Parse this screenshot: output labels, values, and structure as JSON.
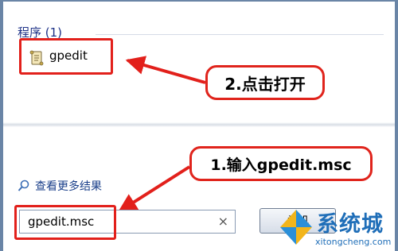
{
  "start_menu": {
    "section_header": "程序 (1)",
    "program_item": {
      "label": "gpedit",
      "icon": "document-scroll-icon"
    },
    "more_results": {
      "label": "查看更多结果",
      "icon": "magnifier-icon"
    },
    "search": {
      "value": "gpedit.msc",
      "clear_icon": "×"
    },
    "shutdown_button": {
      "label": "关机"
    }
  },
  "annotations": {
    "step1": "1.输入gpedit.msc",
    "step2": "2.点击打开",
    "highlight_color": "#e2201b"
  },
  "watermark": {
    "title": "系统城",
    "url": "xitongcheng.com"
  }
}
